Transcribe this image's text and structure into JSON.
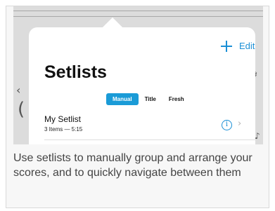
{
  "popover": {
    "add_icon": "plus-icon",
    "edit_label": "Edit",
    "title": "Setlists",
    "sort_options": [
      {
        "label": "Manual",
        "active": true
      },
      {
        "label": "Title",
        "active": false
      },
      {
        "label": "Fresh",
        "active": false
      }
    ],
    "setlist": {
      "title": "My Setlist",
      "subtitle": "3 Items — 5:15",
      "info_icon": "info-icon",
      "chevron_icon": "chevron-right-icon"
    }
  },
  "caption": "Use setlists to manually group and arrange your scores, and to quickly navigate between them",
  "colors": {
    "accent": "#1a8fd6",
    "segment_active": "#1a9bd7",
    "caption_text": "#444444",
    "card_background": "#f7f7f7"
  }
}
